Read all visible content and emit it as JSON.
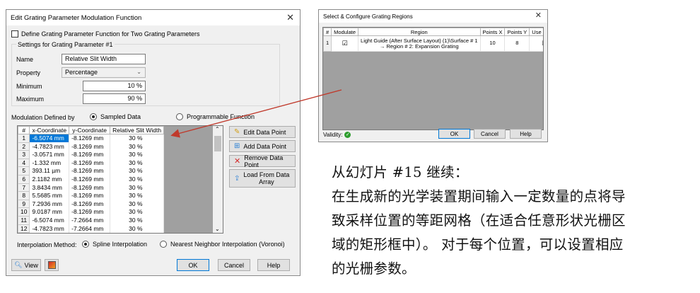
{
  "dialog1": {
    "title": "Edit Grating Parameter Modulation Function",
    "two_param_label": "Define Grating Parameter Function for Two Grating Parameters",
    "settings_group": "Settings for Grating Parameter #1",
    "name_label": "Name",
    "name_value": "Relative Slit Width",
    "property_label": "Property",
    "property_value": "Percentage",
    "minimum_label": "Minimum",
    "minimum_value": "10 %",
    "maximum_label": "Maximum",
    "maximum_value": "90 %",
    "modulation_label": "Modulation Defined by",
    "sampled_label": "Sampled Data",
    "programmable_label": "Programmable Function",
    "table": {
      "headers": [
        "#",
        "x-Coordinate",
        "y-Coordinate",
        "Relative Slit Width"
      ],
      "rows": [
        [
          "1",
          "-6.5074 mm",
          "-8.1269 mm",
          "30 %"
        ],
        [
          "2",
          "-4.7823 mm",
          "-8.1269 mm",
          "30 %"
        ],
        [
          "3",
          "-3.0571 mm",
          "-8.1269 mm",
          "30 %"
        ],
        [
          "4",
          "-1.332 mm",
          "-8.1269 mm",
          "30 %"
        ],
        [
          "5",
          "393.11 µm",
          "-8.1269 mm",
          "30 %"
        ],
        [
          "6",
          "2.1182 mm",
          "-8.1269 mm",
          "30 %"
        ],
        [
          "7",
          "3.8434 mm",
          "-8.1269 mm",
          "30 %"
        ],
        [
          "8",
          "5.5685 mm",
          "-8.1269 mm",
          "30 %"
        ],
        [
          "9",
          "7.2936 mm",
          "-8.1269 mm",
          "30 %"
        ],
        [
          "10",
          "9.0187 mm",
          "-8.1269 mm",
          "30 %"
        ],
        [
          "11",
          "-6.5074 mm",
          "-7.2664 mm",
          "30 %"
        ],
        [
          "12",
          "-4.7823 mm",
          "-7.2664 mm",
          "30 %"
        ]
      ]
    },
    "edit_btn": "Edit Data Point",
    "add_btn": "Add Data Point",
    "remove_btn": "Remove Data Point",
    "load_btn_line1": "Load From Data",
    "load_btn_line2": "Array",
    "interp_label": "Interpolation Method:",
    "spline_label": "Spline Interpolation",
    "nearest_label": "Nearest Neighbor Interpolation (Voronoi)",
    "view_btn": "View",
    "ok_btn": "OK",
    "cancel_btn": "Cancel",
    "help_btn": "Help"
  },
  "dialog2": {
    "title": "Select & Configure Grating Regions",
    "headers": [
      "#",
      "Modulate",
      "Region",
      "Points X",
      "Points Y",
      "Use Spline"
    ],
    "row": {
      "index": "1",
      "region_line1": "Light Guide (After Surface Layout) (1)\\Surface # 1",
      "region_line2": "→ Region # 2: Expansion Grating",
      "points_x": "10",
      "points_y": "8"
    },
    "validity_label": "Validity:",
    "ok_btn": "OK",
    "cancel_btn": "Cancel",
    "help_btn": "Help"
  },
  "slide_text": {
    "line1": "从幻灯片 #15 继续：",
    "line2": "在生成新的光学装置期间输入一定数量的点将导",
    "line3": "致采样位置的等距网格（在适合任意形状光栅区",
    "line4": "域的矩形框中）。 对于每个位置，可以设置相应",
    "line5": "的光栅参数。"
  },
  "colors": {
    "selected_row": "#0078d7",
    "arrow": "#c0392b",
    "validity_ok": "#2e9d2e"
  }
}
